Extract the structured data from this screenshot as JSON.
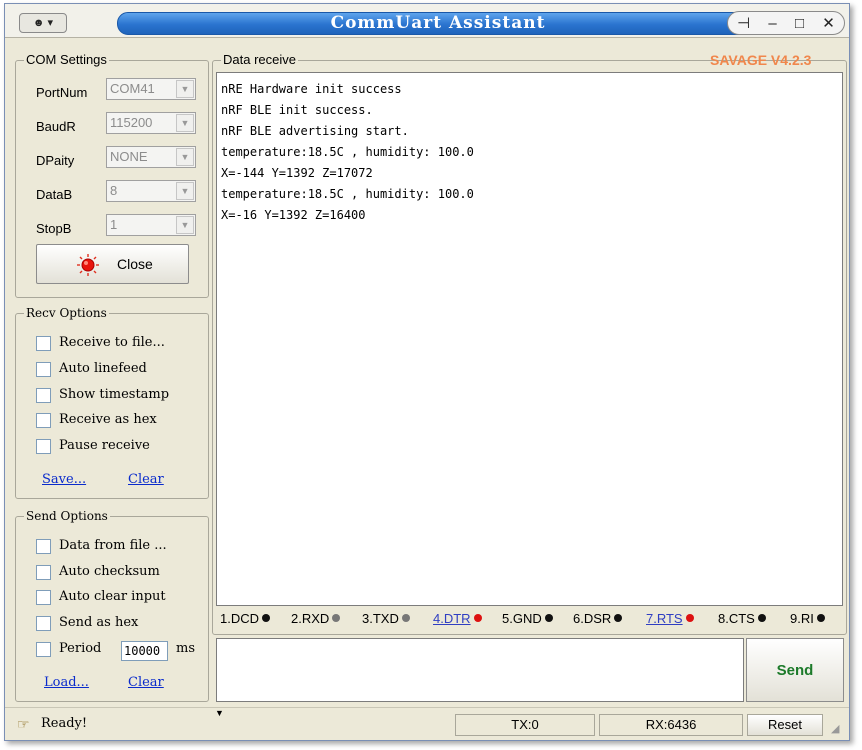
{
  "window": {
    "title": "CommUart Assistant"
  },
  "com_settings": {
    "title": "COM Settings",
    "fields": [
      {
        "label": "PortNum",
        "value": "COM41"
      },
      {
        "label": "BaudR",
        "value": "115200"
      },
      {
        "label": "DPaity",
        "value": "NONE"
      },
      {
        "label": "DataB",
        "value": "8"
      },
      {
        "label": "StopB",
        "value": "1"
      }
    ],
    "close_label": "Close"
  },
  "recv_options": {
    "title": "Recv Options",
    "checkboxes": [
      "Receive to file...",
      "Auto linefeed",
      "Show timestamp",
      "Receive as hex",
      "Pause receive"
    ],
    "save_label": "Save...",
    "clear_label": "Clear"
  },
  "send_options": {
    "title": "Send Options",
    "checkboxes": [
      "Data from file ...",
      "Auto checksum",
      "Auto clear input",
      "Send as hex",
      "Period"
    ],
    "period_value": "10000",
    "period_unit": "ms",
    "load_label": "Load...",
    "clear_label": "Clear"
  },
  "data_receive": {
    "title": "Data receive",
    "version": "SAVAGE V4.2.3",
    "lines": [
      "nRE Hardware init success",
      "nRF BLE init success.",
      "nRF BLE advertising start.",
      "temperature:18.5C , humidity: 100.0",
      "X=-144 Y=1392 Z=17072",
      "temperature:18.5C , humidity: 100.0",
      "X=-16 Y=1392 Z=16400"
    ]
  },
  "pins": [
    {
      "label": "1.DCD",
      "color": "#111111",
      "link": false
    },
    {
      "label": "2.RXD",
      "color": "#777777",
      "link": false
    },
    {
      "label": "3.TXD",
      "color": "#777777",
      "link": false
    },
    {
      "label": "4.DTR",
      "color": "#dd1111",
      "link": true
    },
    {
      "label": "5.GND",
      "color": "#111111",
      "link": false
    },
    {
      "label": "6.DSR",
      "color": "#111111",
      "link": false
    },
    {
      "label": "7.RTS",
      "color": "#dd1111",
      "link": true
    },
    {
      "label": "8.CTS",
      "color": "#111111",
      "link": false
    },
    {
      "label": "9.RI",
      "color": "#111111",
      "link": false
    }
  ],
  "send": {
    "button_label": "Send"
  },
  "status": {
    "text": "Ready!",
    "tx": "TX:0",
    "rx": "RX:6436",
    "reset_label": "Reset"
  },
  "colors": {
    "title_blue": "#2a74cf",
    "version_orange": "#f0874c",
    "send_green": "#1c7a2a",
    "link_blue": "#0a2bcc"
  }
}
